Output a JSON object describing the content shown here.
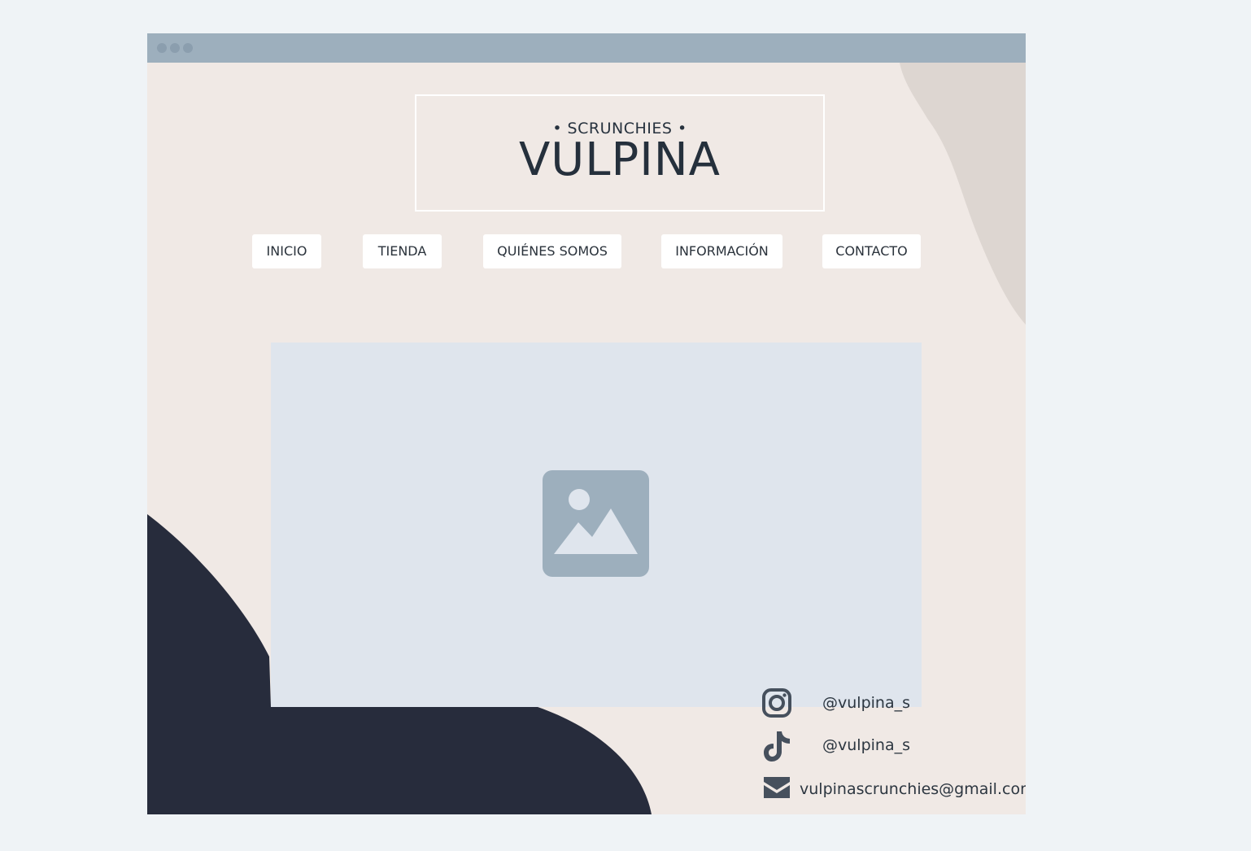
{
  "window": {
    "titlebar_dots": 3
  },
  "header": {
    "subtitle": "• SCRUNCHIES •",
    "title": "VULPINA"
  },
  "nav": {
    "items": [
      {
        "label": "INICIO"
      },
      {
        "label": "TIENDA"
      },
      {
        "label": "QUIÉNES SOMOS"
      },
      {
        "label": "INFORMACIÓN"
      },
      {
        "label": "CONTACTO"
      }
    ]
  },
  "hero": {
    "icon": "image-placeholder-icon"
  },
  "contact": {
    "instagram": "@vulpina_s",
    "tiktok": "@vulpina_s",
    "email": "vulpinascrunchies@gmail.com"
  },
  "colors": {
    "page_bg": "#eff3f6",
    "titlebar": "#9dafbd",
    "paper": "#f0e9e5",
    "dark_shape": "#272c3c",
    "text": "#25303c",
    "placeholder": "#dfe5ed",
    "placeholder_icon": "#9dafbd"
  }
}
